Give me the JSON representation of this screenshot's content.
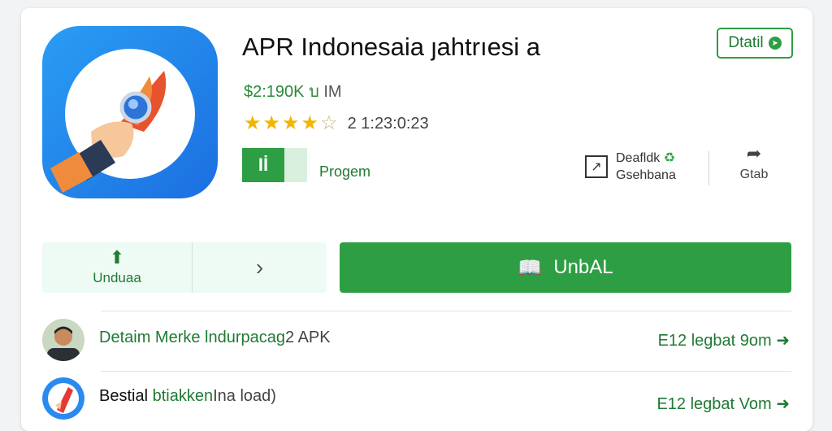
{
  "app": {
    "title": "APR Indonesaia ȷahtrıesi a",
    "price": "$2:190K บ",
    "price_unit": "IM",
    "rating_stars": 4.5,
    "rating_count": "2  1:23:0:23",
    "badge_label": "Iİ",
    "program_label": "Progem"
  },
  "detail_button": {
    "label": "Dtatil",
    "icon": "arrow-circle-icon"
  },
  "meta": {
    "line1": "Deafldk",
    "line1_icon": "recycle-icon",
    "line2": "Gsehbana"
  },
  "share": {
    "label": "Gtab",
    "icon": "share-arrow-icon"
  },
  "download": {
    "secondary_label": "Unduaa",
    "secondary_icon": "download-icon",
    "more_icon": "chevron-right-icon",
    "main_label": "UnbAL",
    "main_icon": "book-icon"
  },
  "list": [
    {
      "title_green": "Detaim Merkе lndurpacag",
      "title_gray": "2 APK",
      "right": "E12  legbat 9om",
      "right_icon": "check-arrow-icon",
      "avatar": "person-avatar"
    },
    {
      "title_green": "Bestial",
      "title_dark": "btiakken",
      "title_gray": "Ina load)",
      "right": "E12  legbat Vom",
      "right_icon": "check-arrow-icon",
      "avatar": "app-avatar"
    }
  ],
  "colors": {
    "accent": "#2e9e44",
    "icon_bg": "#1b6fe0",
    "star": "#f4b400"
  }
}
